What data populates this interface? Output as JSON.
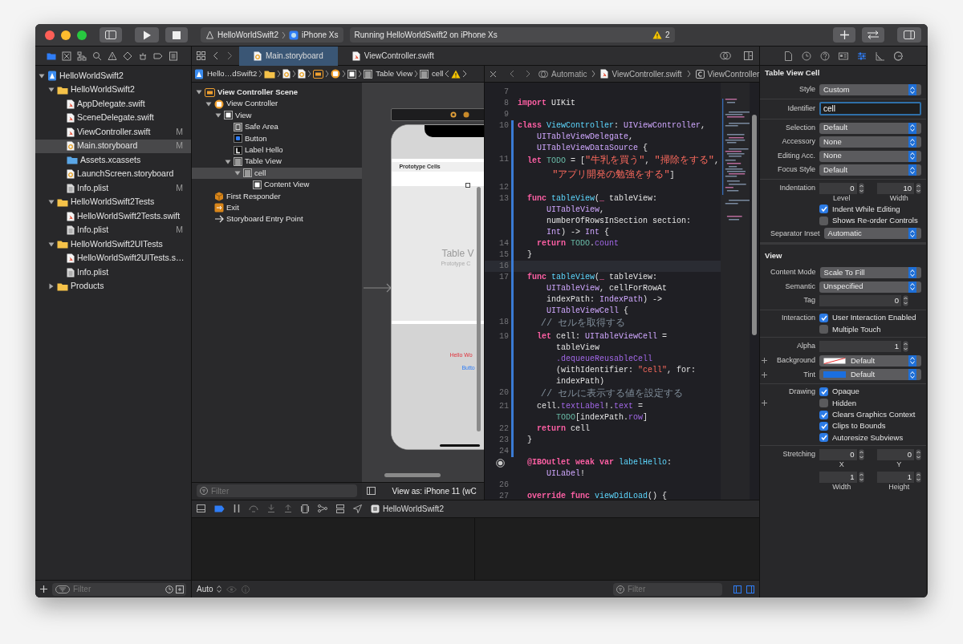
{
  "toolbar": {
    "scheme": "HelloWorldSwift2",
    "device": "iPhone Xs",
    "activity": "Running HelloWorldSwift2 on iPhone Xs",
    "warning_count": "2"
  },
  "navigator": {
    "tabs": [
      {
        "kind": "project",
        "selected": true
      },
      {
        "kind": "source",
        "selected": false
      },
      {
        "kind": "symbols",
        "selected": false
      },
      {
        "kind": "find",
        "selected": false
      },
      {
        "kind": "issues",
        "selected": false
      },
      {
        "kind": "tests",
        "selected": false
      },
      {
        "kind": "debug",
        "selected": false
      },
      {
        "kind": "breakpoints",
        "selected": false
      },
      {
        "kind": "reports",
        "selected": false
      }
    ],
    "tree": [
      {
        "label": "HelloWorldSwift2",
        "kind": "project",
        "expanded": true,
        "selected": false,
        "children": [
          {
            "label": "HelloWorldSwift2",
            "kind": "folder",
            "expanded": true,
            "selected": false,
            "children": [
              {
                "label": "AppDelegate.swift",
                "kind": "swift",
                "selected": false
              },
              {
                "label": "SceneDelegate.swift",
                "kind": "swift",
                "selected": false
              },
              {
                "label": "ViewController.swift",
                "kind": "swift",
                "selected": false,
                "badge": "M"
              },
              {
                "label": "Main.storyboard",
                "kind": "storyboard",
                "selected": true,
                "badge": "M"
              },
              {
                "label": "Assets.xcassets",
                "kind": "assets",
                "selected": false
              },
              {
                "label": "LaunchScreen.storyboard",
                "kind": "storyboard",
                "selected": false
              },
              {
                "label": "Info.plist",
                "kind": "plist",
                "selected": false,
                "badge": "M"
              }
            ]
          },
          {
            "label": "HelloWorldSwift2Tests",
            "kind": "folder",
            "expanded": true,
            "selected": false,
            "children": [
              {
                "label": "HelloWorldSwift2Tests.swift",
                "kind": "swift",
                "selected": false
              },
              {
                "label": "Info.plist",
                "kind": "plist",
                "selected": false,
                "badge": "M"
              }
            ]
          },
          {
            "label": "HelloWorldSwift2UITests",
            "kind": "folder",
            "expanded": true,
            "selected": false,
            "children": [
              {
                "label": "HelloWorldSwift2UITests.s…",
                "kind": "swift",
                "selected": false
              },
              {
                "label": "Info.plist",
                "kind": "plist",
                "selected": false
              }
            ]
          },
          {
            "label": "Products",
            "kind": "folder",
            "expanded": false,
            "selected": false
          }
        ]
      }
    ],
    "filter_placeholder": "Filter"
  },
  "editor_tabs": [
    {
      "label": "Main.storyboard",
      "kind": "storyboard",
      "selected": true
    },
    {
      "label": "ViewController.swift",
      "kind": "swift",
      "selected": false
    }
  ],
  "storyboard": {
    "jump_bar": [
      {
        "kind": "project",
        "label": "Hello…dSwift2"
      },
      {
        "kind": "folder"
      },
      {
        "kind": "storyboard"
      },
      {
        "kind": "storyboard"
      },
      {
        "kind": "scene"
      },
      {
        "kind": "controller"
      },
      {
        "kind": "view"
      },
      {
        "kind": "table",
        "label": "Table View"
      },
      {
        "kind": "cell",
        "label": "cell"
      }
    ],
    "outline": [
      {
        "label": "View Controller Scene",
        "kind": "scene",
        "expanded": true,
        "selected": false,
        "children": [
          {
            "label": "View Controller",
            "kind": "controller",
            "expanded": true,
            "selected": false,
            "children": [
              {
                "label": "View",
                "kind": "view",
                "expanded": true,
                "selected": false,
                "children": [
                  {
                    "label": "Safe Area",
                    "kind": "safearea",
                    "selected": false
                  },
                  {
                    "label": "Button",
                    "kind": "button",
                    "selected": false
                  },
                  {
                    "label": "Label Hello",
                    "kind": "label",
                    "selected": false
                  },
                  {
                    "label": "Table View",
                    "kind": "table",
                    "expanded": true,
                    "selected": false,
                    "children": [
                      {
                        "label": "cell",
                        "kind": "cell",
                        "expanded": true,
                        "selected": true,
                        "children": [
                          {
                            "label": "Content View",
                            "kind": "view",
                            "selected": false
                          }
                        ]
                      }
                    ]
                  }
                ]
              }
            ]
          },
          {
            "label": "First Responder",
            "kind": "responder",
            "selected": false
          },
          {
            "label": "Exit",
            "kind": "exit",
            "selected": false
          },
          {
            "label": "Storyboard Entry Point",
            "kind": "entry",
            "selected": false
          }
        ]
      }
    ],
    "filter_placeholder": "Filter",
    "canvas": {
      "section_header": "Prototype Cells",
      "table_title": "Table V",
      "table_subtitle": "Prototype C",
      "label_text": "Hello Wo",
      "button_text": "Butto"
    },
    "view_as": "View as: iPhone 11 (wC"
  },
  "code_editor": {
    "jump_bar": {
      "mode": "Automatic",
      "file": "ViewController.swift",
      "symbol": "ViewController"
    },
    "lines": [
      {
        "number": "7",
        "kind": "code",
        "current": false,
        "changed": false
      },
      {
        "number": "8",
        "kind": "code",
        "current": false,
        "changed": false,
        "segments": [
          {
            "tokens": [
              {
                "kind": "keyword",
                "text": "import "
              },
              {
                "kind": "plain",
                "text": "UIKit"
              }
            ]
          }
        ]
      },
      {
        "number": "9",
        "kind": "code",
        "current": false,
        "changed": false
      },
      {
        "number": "10",
        "kind": "code",
        "current": false,
        "changed": true,
        "segments": [
          {
            "tokens": [
              {
                "kind": "keyword",
                "text": "class "
              },
              {
                "kind": "declaration",
                "text": "ViewController"
              },
              {
                "kind": "plain",
                "text": ": "
              },
              {
                "kind": "type",
                "text": "UIViewController"
              },
              {
                "kind": "plain",
                "text": ","
              }
            ]
          },
          {
            "tokens": [
              {
                "kind": "type",
                "text": "    UITableViewDelegate"
              },
              {
                "kind": "plain",
                "text": ","
              }
            ]
          },
          {
            "tokens": [
              {
                "kind": "type",
                "text": "    UITableViewDataSource"
              },
              {
                "kind": "plain",
                "text": " {"
              }
            ]
          }
        ]
      },
      {
        "number": "11",
        "kind": "code",
        "current": false,
        "changed": true,
        "segments": [
          {
            "tokens": [
              {
                "kind": "keyword",
                "text": "  let "
              },
              {
                "kind": "project",
                "text": "TODO"
              },
              {
                "kind": "plain",
                "text": " = ["
              },
              {
                "kind": "string",
                "text": "\"牛乳を買う\""
              },
              {
                "kind": "plain",
                "text": ", "
              },
              {
                "kind": "string",
                "text": "\"掃除をする\""
              },
              {
                "kind": "plain",
                "text": ","
              }
            ]
          },
          {
            "tokens": [
              {
                "kind": "string",
                "text": "      \"アプリ開発の勉強をする\""
              },
              {
                "kind": "plain",
                "text": "]"
              }
            ]
          }
        ]
      },
      {
        "number": "12",
        "kind": "code",
        "current": false,
        "changed": true
      },
      {
        "number": "13",
        "kind": "code",
        "current": false,
        "changed": true,
        "segments": [
          {
            "tokens": [
              {
                "kind": "keyword",
                "text": "  func "
              },
              {
                "kind": "declaration",
                "text": "tableView"
              },
              {
                "kind": "plain",
                "text": "("
              },
              {
                "kind": "keyword",
                "text": "_"
              },
              {
                "kind": "plain",
                "text": " tableView:"
              }
            ]
          },
          {
            "tokens": [
              {
                "kind": "type",
                "text": "      UITableView"
              },
              {
                "kind": "plain",
                "text": ","
              }
            ]
          },
          {
            "tokens": [
              {
                "kind": "plain",
                "text": "      numberOfRowsInSection section:"
              }
            ]
          },
          {
            "tokens": [
              {
                "kind": "type",
                "text": "      Int"
              },
              {
                "kind": "plain",
                "text": ") -> "
              },
              {
                "kind": "type",
                "text": "Int"
              },
              {
                "kind": "plain",
                "text": " {"
              }
            ]
          }
        ]
      },
      {
        "number": "14",
        "kind": "code",
        "current": false,
        "changed": true,
        "segments": [
          {
            "tokens": [
              {
                "kind": "keyword",
                "text": "    return "
              },
              {
                "kind": "project",
                "text": "TODO"
              },
              {
                "kind": "plain",
                "text": "."
              },
              {
                "kind": "property",
                "text": "count"
              }
            ]
          }
        ]
      },
      {
        "number": "15",
        "kind": "code",
        "current": false,
        "changed": true,
        "segments": [
          {
            "tokens": [
              {
                "kind": "plain",
                "text": "  }"
              }
            ]
          }
        ]
      },
      {
        "number": "16",
        "kind": "code",
        "current": true,
        "changed": true
      },
      {
        "number": "17",
        "kind": "code",
        "current": false,
        "changed": true,
        "segments": [
          {
            "tokens": [
              {
                "kind": "keyword",
                "text": "  func "
              },
              {
                "kind": "declaration",
                "text": "tableView"
              },
              {
                "kind": "plain",
                "text": "("
              },
              {
                "kind": "keyword",
                "text": "_"
              },
              {
                "kind": "plain",
                "text": " tableView:"
              }
            ]
          },
          {
            "tokens": [
              {
                "kind": "type",
                "text": "      UITableView"
              },
              {
                "kind": "plain",
                "text": ", cellForRowAt"
              }
            ]
          },
          {
            "tokens": [
              {
                "kind": "plain",
                "text": "      indexPath: "
              },
              {
                "kind": "type",
                "text": "IndexPath"
              },
              {
                "kind": "plain",
                "text": ") ->"
              }
            ]
          },
          {
            "tokens": [
              {
                "kind": "type",
                "text": "      UITableViewCell"
              },
              {
                "kind": "plain",
                "text": " {"
              }
            ]
          }
        ]
      },
      {
        "number": "18",
        "kind": "code",
        "current": false,
        "changed": true,
        "segments": [
          {
            "tokens": [
              {
                "kind": "comment",
                "text": "    // セルを取得する"
              }
            ]
          }
        ]
      },
      {
        "number": "19",
        "kind": "code",
        "current": false,
        "changed": true,
        "segments": [
          {
            "tokens": [
              {
                "kind": "keyword",
                "text": "    let "
              },
              {
                "kind": "plain",
                "text": "cell: "
              },
              {
                "kind": "type",
                "text": "UITableViewCell"
              },
              {
                "kind": "plain",
                "text": " ="
              }
            ]
          },
          {
            "tokens": [
              {
                "kind": "plain",
                "text": "        tableView"
              }
            ]
          },
          {
            "tokens": [
              {
                "kind": "property",
                "text": "        .dequeueReusableCell"
              }
            ]
          },
          {
            "tokens": [
              {
                "kind": "plain",
                "text": "        (withIdentifier: "
              },
              {
                "kind": "string",
                "text": "\"cell\""
              },
              {
                "kind": "plain",
                "text": ", for:"
              }
            ]
          },
          {
            "tokens": [
              {
                "kind": "plain",
                "text": "        indexPath)"
              }
            ]
          }
        ]
      },
      {
        "number": "20",
        "kind": "code",
        "current": false,
        "changed": true,
        "segments": [
          {
            "tokens": [
              {
                "kind": "comment",
                "text": "    // セルに表示する値を設定する"
              }
            ]
          }
        ]
      },
      {
        "number": "21",
        "kind": "code",
        "current": false,
        "changed": true,
        "segments": [
          {
            "tokens": [
              {
                "kind": "plain",
                "text": "    cell."
              },
              {
                "kind": "property",
                "text": "textLabel"
              },
              {
                "kind": "plain",
                "text": "!."
              },
              {
                "kind": "property",
                "text": "text"
              },
              {
                "kind": "plain",
                "text": " ="
              }
            ]
          },
          {
            "tokens": [
              {
                "kind": "project",
                "text": "        TODO"
              },
              {
                "kind": "plain",
                "text": "[indexPath."
              },
              {
                "kind": "property",
                "text": "row"
              },
              {
                "kind": "plain",
                "text": "]"
              }
            ]
          }
        ]
      },
      {
        "number": "22",
        "kind": "code",
        "current": false,
        "changed": true,
        "segments": [
          {
            "tokens": [
              {
                "kind": "keyword",
                "text": "    return "
              },
              {
                "kind": "plain",
                "text": "cell"
              }
            ]
          }
        ]
      },
      {
        "number": "23",
        "kind": "code",
        "current": false,
        "changed": true,
        "segments": [
          {
            "tokens": [
              {
                "kind": "plain",
                "text": "  }"
              }
            ]
          }
        ]
      },
      {
        "number": "24",
        "kind": "code",
        "current": false,
        "changed": true
      },
      {
        "kind": "outlet",
        "current": false,
        "changed": false,
        "segments": [
          {
            "tokens": [
              {
                "kind": "keyword",
                "text": "  @IBOutlet weak var "
              },
              {
                "kind": "declaration",
                "text": "labelHello"
              },
              {
                "kind": "plain",
                "text": ":"
              }
            ]
          },
          {
            "tokens": [
              {
                "kind": "type",
                "text": "      UILabel"
              },
              {
                "kind": "plain",
                "text": "!"
              }
            ]
          }
        ]
      },
      {
        "number": "26",
        "kind": "code",
        "current": false,
        "changed": false
      },
      {
        "number": "27",
        "kind": "code",
        "current": false,
        "changed": false,
        "segments": [
          {
            "tokens": [
              {
                "kind": "keyword",
                "text": "  override func "
              },
              {
                "kind": "declaration",
                "text": "viewDidLoad"
              },
              {
                "kind": "plain",
                "text": "() {"
              }
            ]
          }
        ]
      }
    ]
  },
  "debug": {
    "breakpoints_active": true,
    "process": "HelloWorldSwift2",
    "variables_mode": "Auto",
    "filter_placeholder": "Filter"
  },
  "inspector": {
    "tabs": [
      {
        "kind": "file",
        "selected": false
      },
      {
        "kind": "history",
        "selected": false
      },
      {
        "kind": "help",
        "selected": false
      },
      {
        "kind": "identity",
        "selected": false
      },
      {
        "kind": "attributes",
        "selected": true
      },
      {
        "kind": "size",
        "selected": false
      },
      {
        "kind": "connections",
        "selected": false
      }
    ],
    "sections": [
      {
        "title": "Table View Cell",
        "groups": [
          [
            {
              "kind": "popup",
              "label": "Style",
              "value": "Custom"
            }
          ],
          [
            {
              "kind": "field",
              "label": "Identifier",
              "value": "cell",
              "focused": true
            }
          ],
          [
            {
              "kind": "popup",
              "label": "Selection",
              "value": "Default"
            },
            {
              "kind": "popup",
              "label": "Accessory",
              "value": "None"
            },
            {
              "kind": "popup",
              "label": "Editing Acc.",
              "value": "None"
            },
            {
              "kind": "popup",
              "label": "Focus Style",
              "value": "Default"
            }
          ],
          [
            {
              "kind": "steppers",
              "label": "Indentation",
              "fields": [
                {
                  "value": "0",
                  "caption": "Level"
                },
                {
                  "value": "10",
                  "caption": "Width"
                }
              ]
            },
            {
              "kind": "checkbox",
              "text": "Indent While Editing",
              "checked": true,
              "plus": false
            },
            {
              "kind": "checkbox",
              "text": "Shows Re-order Controls",
              "checked": false,
              "plus": false
            },
            {
              "kind": "popup",
              "label": "Separator Inset",
              "value": "Automatic"
            }
          ]
        ]
      },
      {
        "title": "View",
        "groups": [
          [
            {
              "kind": "popup",
              "label": "Content Mode",
              "value": "Scale To Fill"
            },
            {
              "kind": "popup",
              "label": "Semantic",
              "value": "Unspecified"
            },
            {
              "kind": "steppers",
              "label": "Tag",
              "fields": [
                {
                  "value": "0"
                }
              ]
            }
          ],
          [
            {
              "kind": "checkbox",
              "label": "Interaction",
              "text": "User Interaction Enabled",
              "checked": true,
              "plus": false
            },
            {
              "kind": "checkbox",
              "text": "Multiple Touch",
              "checked": false,
              "plus": false
            }
          ],
          [
            {
              "kind": "steppers",
              "label": "Alpha",
              "fields": [
                {
                  "value": "1"
                }
              ]
            },
            {
              "kind": "color",
              "label": "Background",
              "value": "Default",
              "cleared": true,
              "plus": true
            },
            {
              "kind": "color",
              "label": "Tint",
              "value": "Default",
              "cleared": false,
              "color": "#1b6fe0",
              "plus": true
            }
          ],
          [
            {
              "kind": "checkbox",
              "label": "Drawing",
              "text": "Opaque",
              "checked": true,
              "plus": false
            },
            {
              "kind": "checkbox",
              "text": "Hidden",
              "checked": false,
              "plus": true
            },
            {
              "kind": "checkbox",
              "text": "Clears Graphics Context",
              "checked": true,
              "plus": false
            },
            {
              "kind": "checkbox",
              "text": "Clips to Bounds",
              "checked": true,
              "plus": false
            },
            {
              "kind": "checkbox",
              "text": "Autoresize Subviews",
              "checked": true,
              "plus": false
            }
          ],
          [
            {
              "kind": "steppers",
              "label": "Stretching",
              "fields": [
                {
                  "value": "0",
                  "caption": "X"
                },
                {
                  "value": "0",
                  "caption": "Y"
                }
              ]
            },
            {
              "kind": "steppers",
              "fields": [
                {
                  "value": "1",
                  "caption": "Width"
                },
                {
                  "value": "1",
                  "caption": "Height"
                }
              ]
            }
          ]
        ]
      }
    ]
  }
}
